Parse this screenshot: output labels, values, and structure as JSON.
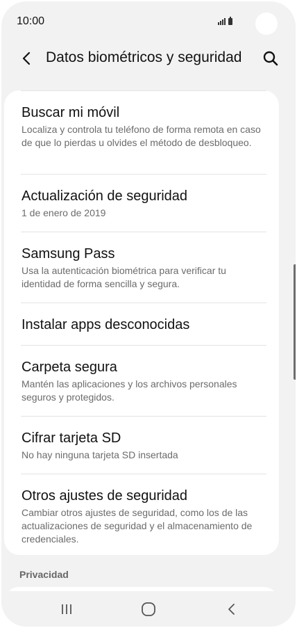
{
  "status_bar": {
    "time": "10:00"
  },
  "header": {
    "title": "Datos biométricos y seguridad",
    "back_icon": "chevron-left-icon",
    "search_icon": "search-icon"
  },
  "items": [
    {
      "title": "Buscar mi móvil",
      "description": "Localiza y controla tu teléfono de forma remota en caso de que lo pierdas u olvides el método de desbloqueo."
    },
    {
      "title": "Actualización de seguridad",
      "description": "1 de enero de 2019"
    },
    {
      "title": "Samsung Pass",
      "description": "Usa la autenticación biométrica para verificar tu identidad de forma sencilla y segura."
    },
    {
      "title": "Instalar apps desconocidas",
      "description": ""
    },
    {
      "title": "Carpeta segura",
      "description": "Mantén las aplicaciones y los archivos personales seguros y protegidos."
    },
    {
      "title": "Cifrar tarjeta SD",
      "description": "No hay ninguna tarjeta SD insertada"
    },
    {
      "title": "Otros ajustes de seguridad",
      "description": "Cambiar otros ajustes de seguridad, como los de las actualizaciones de seguridad y el almacenamiento de credenciales."
    }
  ],
  "sections": {
    "privacy_header": "Privacidad"
  },
  "nav_bar": {
    "recents_icon": "recents-icon",
    "home_icon": "home-icon",
    "back_icon": "back-icon"
  }
}
